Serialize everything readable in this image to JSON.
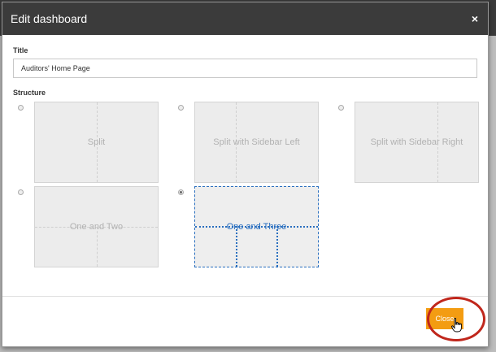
{
  "dialog": {
    "title": "Edit dashboard",
    "close_glyph": "×"
  },
  "form": {
    "title_label": "Title",
    "title_value": "Auditors' Home Page",
    "structure_label": "Structure"
  },
  "layouts": [
    {
      "label": "Split",
      "selected": false
    },
    {
      "label": "Split with Sidebar Left",
      "selected": false
    },
    {
      "label": "Split with Sidebar Right",
      "selected": false
    },
    {
      "label": "One and Two",
      "selected": false
    },
    {
      "label": "One and Three",
      "selected": true
    }
  ],
  "footer": {
    "close_label": "Close"
  },
  "colors": {
    "accent": "#f39c12",
    "highlight_ring": "#c0271c",
    "selected_outline": "#2a6fbf",
    "header": "#3b3b3b"
  },
  "icons": {
    "cursor": "hand-pointer-icon"
  }
}
